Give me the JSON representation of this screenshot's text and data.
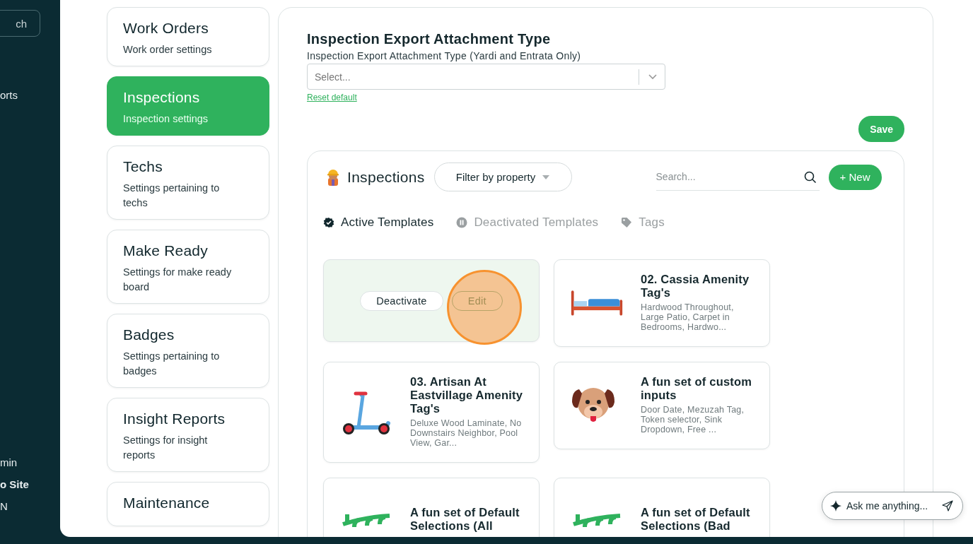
{
  "sidebar": {
    "search": {
      "placeholder": "ch"
    },
    "items": [
      {
        "label": "orts",
        "kind": "nav"
      },
      {
        "label": "min",
        "kind": "footer",
        "bold": false
      },
      {
        "label": "o Site",
        "kind": "footer",
        "bold": true
      },
      {
        "label": "N",
        "kind": "footer",
        "bold": false
      }
    ]
  },
  "settings_nav": [
    {
      "title": "Work Orders",
      "subtitle": "Work order settings",
      "selected": false
    },
    {
      "title": "Inspections",
      "subtitle": "Inspection settings",
      "selected": true
    },
    {
      "title": "Techs",
      "subtitle": "Settings pertaining to techs",
      "selected": false
    },
    {
      "title": "Make Ready",
      "subtitle": "Settings for make ready board",
      "selected": false
    },
    {
      "title": "Badges",
      "subtitle": "Settings pertaining to badges",
      "selected": false
    },
    {
      "title": "Insight Reports",
      "subtitle": "Settings for insight reports",
      "selected": false
    },
    {
      "title": "Maintenance",
      "selected": false
    }
  ],
  "export_setting": {
    "title": "Inspection Export Attachment Type",
    "label": "Inspection Export Attachment Type (Yardi and Entrata Only)",
    "select": {
      "placeholder": "Select..."
    },
    "reset_link": "Reset default"
  },
  "save_button": "Save",
  "inspections": {
    "title": "Inspections",
    "filter": {
      "label": "Filter by property"
    },
    "search": {
      "placeholder": "Search..."
    },
    "new_button": "+ New",
    "tabs": [
      {
        "label": "Active Templates",
        "selected": true,
        "kind": "check"
      },
      {
        "label": "Deactivated Templates",
        "selected": false,
        "kind": "pause"
      },
      {
        "label": "Tags",
        "selected": false,
        "kind": "tag"
      }
    ],
    "templates": [
      {
        "kind": "actions",
        "actions": [
          {
            "label": "Deactivate",
            "highlighted": false
          },
          {
            "label": "Edit",
            "highlighted": true
          }
        ]
      },
      {
        "kind": "bed",
        "title": "02. Cassia Amenity Tag's",
        "description": "Hardwood Throughout, Large Patio, Carpet in Bedrooms, Hardwo..."
      },
      {
        "kind": "scooter",
        "title": "03. Artisan At Eastvillage Amenity Tag's",
        "description": "Deluxe Wood Laminate, No Downstairs Neighbor, Pool View, Gar..."
      },
      {
        "kind": "dog",
        "title": "A fun set of custom inputs",
        "description": "Door Date, Mezuzah Tag, Token selector, Sink Dropdown, Free ..."
      },
      {
        "kind": "hundred",
        "title": "A fun set of Default Selections (All"
      },
      {
        "kind": "hundred",
        "title": "A fun set of Default Selections (Bad"
      }
    ]
  },
  "assistant": {
    "placeholder": "Ask me anything..."
  }
}
